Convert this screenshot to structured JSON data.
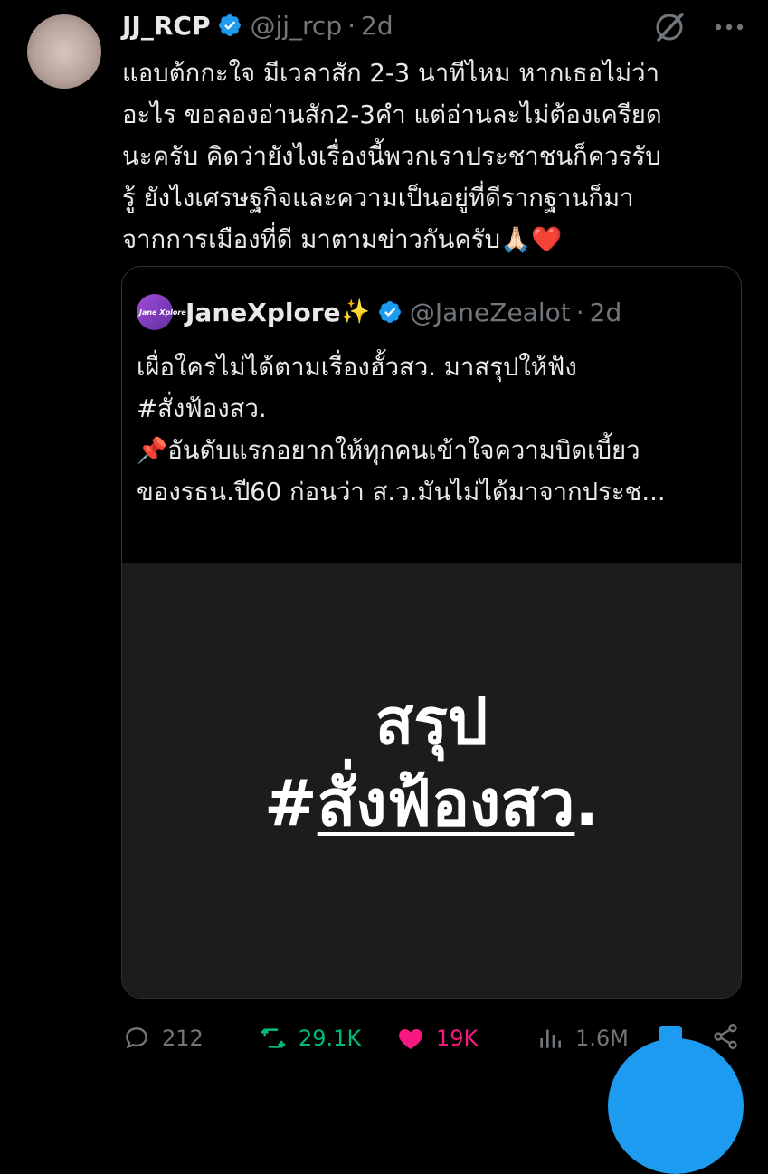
{
  "tweet": {
    "author_name": "JJ_RCP",
    "author_handle": "@jj_rcp",
    "separator": "·",
    "time": "2d",
    "text": "แอบต้กกะใจ มีเวลาสัก 2-3 นาทีไหม หากเธอไม่ว่า\nอะไร ขอลองอ่านสัก2-3คำ แต่อ่านละไม่ต้องเครียด\nนะครับ คิดว่ายังไงเรื่องนี้พวกเราประชาชนก็ควรรับ\nรู้ ยังไงเศรษฐกิจและความเป็นอยู่ที่ดีรากฐานก็มา\nจากการเมืองที่ดี มาตามข่าวกันครับ🙏🏻❤️"
  },
  "quoted": {
    "avatar_text": "Jane Xplore",
    "author_name": "JaneXplore",
    "sparkle": "✨",
    "author_handle": "@JaneZealot",
    "separator": "·",
    "time": "2d",
    "text_line1": "เผื่อใครไม่ได้ตามเรื่องฮั้วสว. มาสรุปให้ฟัง\n#สั่งฟ้องสว.\n",
    "pin": "📌",
    "text_line2": "อันดับแรกอยากให้ทุกคนเข้าใจความบิดเบี้ยว\nของรธน.ปี60 ก่อนว่า ส.ว.มันไม่ได้มาจากประช...",
    "image_line1": "สรุป",
    "image_hash": "#",
    "image_line2": "สั่งฟ้องสว",
    "image_period": "."
  },
  "actions": {
    "replies": "212",
    "retweets": "29.1K",
    "likes": "19K",
    "views": "1.6M"
  },
  "colors": {
    "background": "#000000",
    "text": "#e7e9ea",
    "muted": "#71767b",
    "retweet": "#00ba7c",
    "like": "#f91880",
    "accent": "#1d9bf0"
  }
}
